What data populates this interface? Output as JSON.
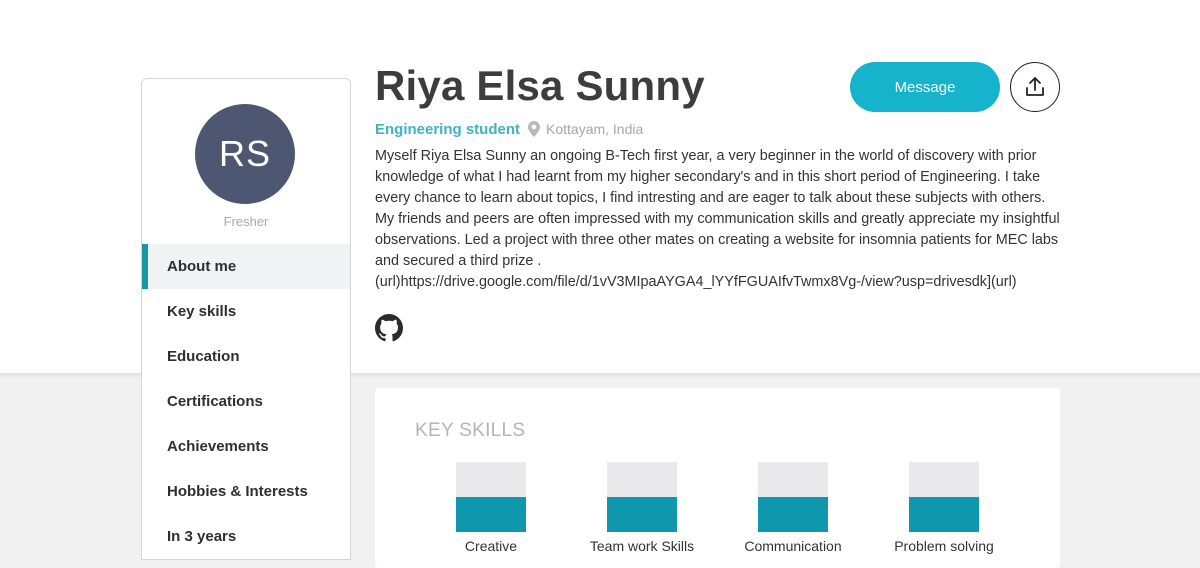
{
  "profile": {
    "initials": "RS",
    "status": "Fresher",
    "name": "Riya Elsa Sunny",
    "role": "Engineering student",
    "location": "Kottayam, India",
    "bio": "Myself Riya Elsa Sunny an ongoing B-Tech first year, a very beginner in the world of discovery with prior knowledge of what I had learnt from my higher secondary's and in this short period of Engineering. I take every chance to learn about topics, I find intresting and are eager to talk about these subjects with others. My friends and peers are often impressed with my communication skills and greatly appreciate my insightful observations. Led a project with three other mates on creating a website for insomnia patients for MEC labs and secured a third prize . (url)https://drive.google.com/file/d/1vV3MIpaAYGA4_lYYfFGUAIfvTwmx8Vg-/view?usp=drivesdk](url)"
  },
  "actions": {
    "message_label": "Message",
    "share_icon": "share-upload-icon",
    "github_icon": "github-icon"
  },
  "sidebar": {
    "items": [
      {
        "label": "About me",
        "active": true
      },
      {
        "label": "Key skills",
        "active": false
      },
      {
        "label": "Education",
        "active": false
      },
      {
        "label": "Certifications",
        "active": false
      },
      {
        "label": "Achievements",
        "active": false
      },
      {
        "label": "Hobbies & Interests",
        "active": false
      },
      {
        "label": "In 3 years",
        "active": false
      }
    ]
  },
  "skills": {
    "title": "KEY SKILLS",
    "items": [
      {
        "label": "Creative",
        "level": 0.5
      },
      {
        "label": "Team work Skills",
        "level": 0.5
      },
      {
        "label": "Communication",
        "level": 0.5
      },
      {
        "label": "Problem solving",
        "level": 0.5
      }
    ]
  },
  "colors": {
    "accent": "#16b3cd",
    "skill_fill": "#0f98ad",
    "avatar_bg": "#4e5772",
    "role_text": "#3fb2c4"
  }
}
